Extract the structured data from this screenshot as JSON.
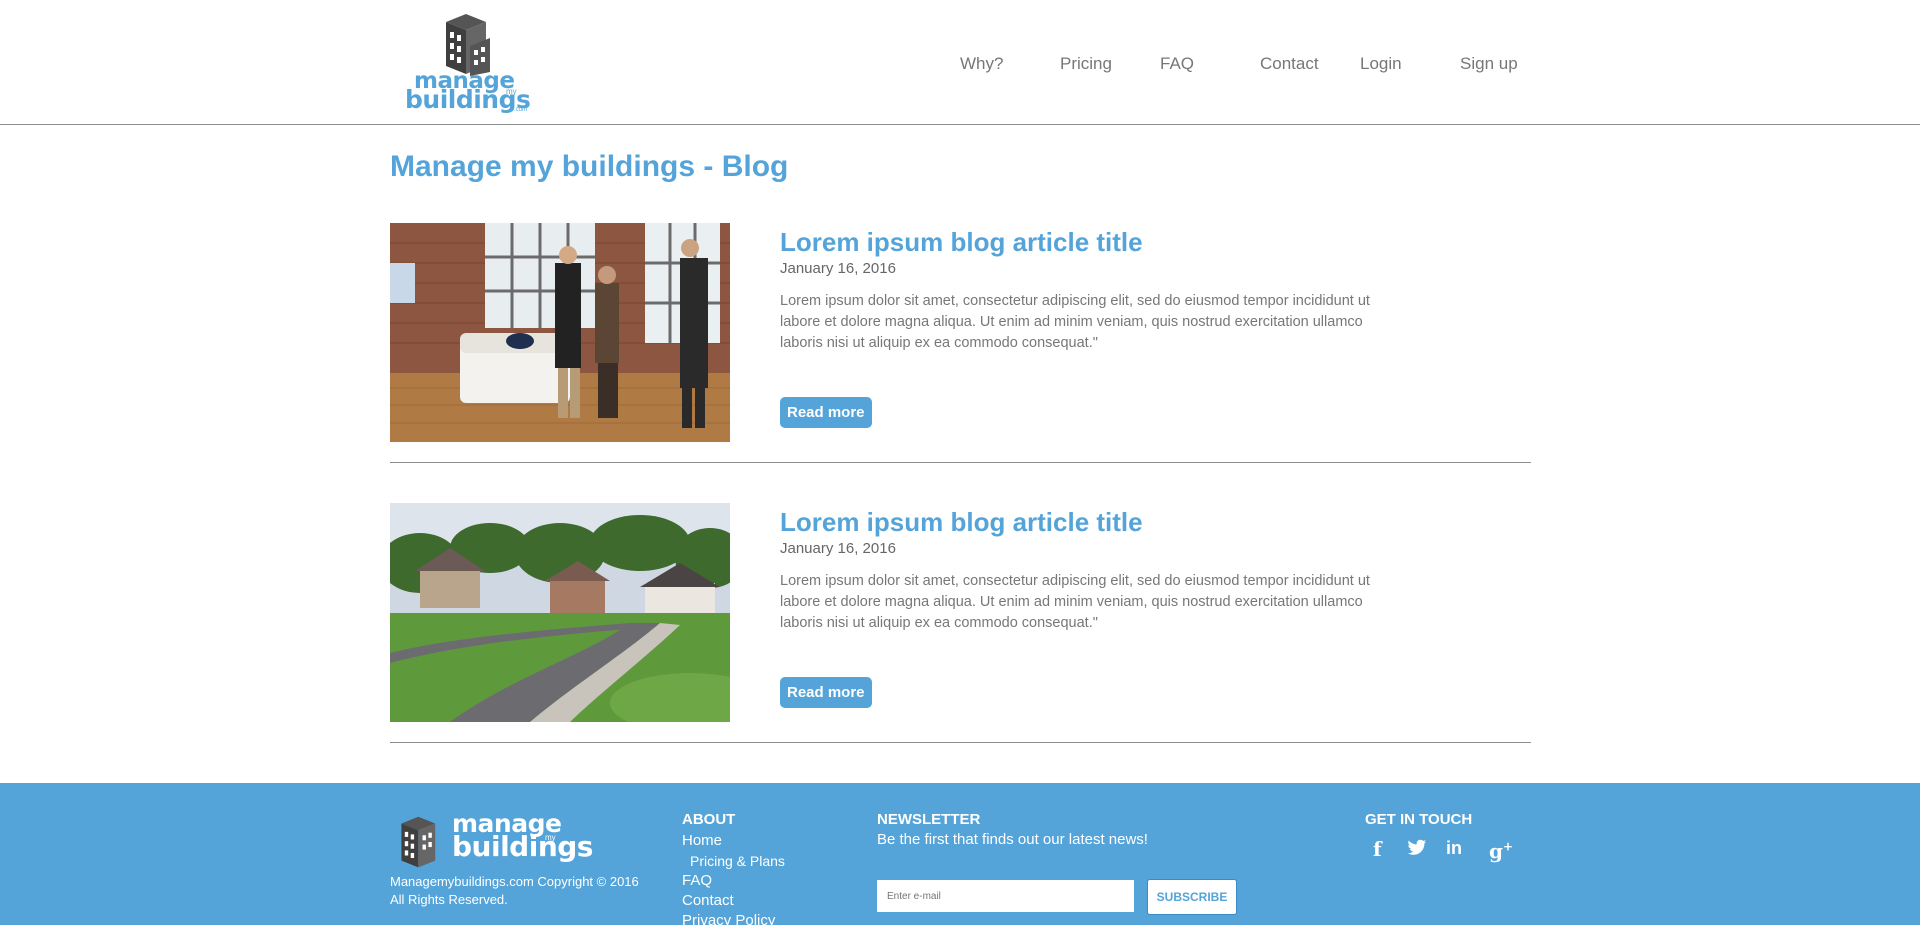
{
  "brand": {
    "logo_word1": "manage",
    "logo_word2": "buildings",
    "logo_my": "my",
    "logo_com": ".com",
    "color": "#54a4d9"
  },
  "nav": {
    "why": "Why?",
    "pricing": "Pricing",
    "faq": "FAQ",
    "contact": "Contact",
    "login": "Login",
    "signup": "Sign up"
  },
  "page": {
    "title": "Manage my buildings - Blog"
  },
  "posts": [
    {
      "title": "Lorem ipsum blog article title",
      "date": "January 16, 2016",
      "excerpt": "Lorem ipsum dolor sit amet, consectetur adipiscing elit, sed do eiusmod tempor incididunt ut labore et dolore magna aliqua. Ut enim ad minim veniam, quis nostrud exercitation ullamco laboris nisi ut aliquip ex ea commodo consequat.\"",
      "read_more": "Read more",
      "image": "people-in-loft-photo"
    },
    {
      "title": "Lorem ipsum blog article title",
      "date": "January 16, 2016",
      "excerpt": "Lorem ipsum dolor sit amet, consectetur adipiscing elit, sed do eiusmod tempor incididunt ut labore et dolore magna aliqua. Ut enim ad minim veniam, quis nostrud exercitation ullamco laboris nisi ut aliquip ex ea commodo consequat.\"",
      "read_more": "Read more",
      "image": "suburban-street-photo"
    }
  ],
  "footer": {
    "copyright_line1": "Managemybuildings.com Copyright © 2016",
    "copyright_line2": "All Rights Reserved.",
    "about": {
      "heading": "ABOUT",
      "links": [
        "Home",
        "Pricing & Plans",
        "FAQ",
        "Contact",
        "Privacy Policy"
      ]
    },
    "newsletter": {
      "heading": "NEWSLETTER",
      "text": "Be the first that finds out our latest news!",
      "placeholder": "Enter e-mail",
      "button": "SUBSCRIBE"
    },
    "get_in_touch": {
      "heading": "GET IN TOUCH",
      "icons": [
        "facebook-icon",
        "twitter-icon",
        "linkedin-icon",
        "google-plus-icon"
      ]
    }
  }
}
